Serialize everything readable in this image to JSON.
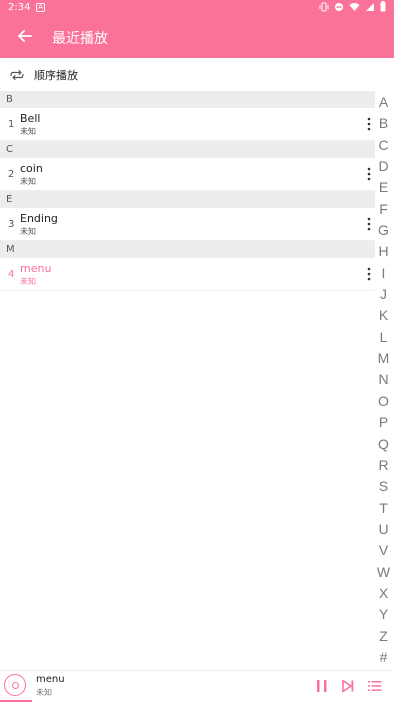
{
  "status_bar": {
    "time": "2:34",
    "notification_letter": "A"
  },
  "app_bar": {
    "title": "最近播放",
    "back_icon": "arrow-back-icon"
  },
  "play_mode": {
    "label": "顺序播放",
    "icon": "repeat-icon"
  },
  "sections": [
    {
      "letter": "B",
      "rows": [
        {
          "num": "1",
          "title": "Bell",
          "artist": "未知",
          "active": false
        }
      ]
    },
    {
      "letter": "C",
      "rows": [
        {
          "num": "2",
          "title": "coin",
          "artist": "未知",
          "active": false
        }
      ]
    },
    {
      "letter": "E",
      "rows": [
        {
          "num": "3",
          "title": "Ending",
          "artist": "未知",
          "active": false
        }
      ]
    },
    {
      "letter": "M",
      "rows": [
        {
          "num": "4",
          "title": "menu",
          "artist": "未知",
          "active": true
        }
      ]
    }
  ],
  "index_letters": [
    "A",
    "B",
    "C",
    "D",
    "E",
    "F",
    "G",
    "H",
    "I",
    "J",
    "K",
    "L",
    "M",
    "N",
    "O",
    "P",
    "Q",
    "R",
    "S",
    "T",
    "U",
    "V",
    "W",
    "X",
    "Y",
    "Z",
    "#"
  ],
  "now_playing": {
    "title": "menu",
    "artist": "未知",
    "progress_fraction": 0.08
  },
  "colors": {
    "accent": "#fb7299",
    "section_bg": "#ededed",
    "index_text": "#7a7a7a"
  }
}
